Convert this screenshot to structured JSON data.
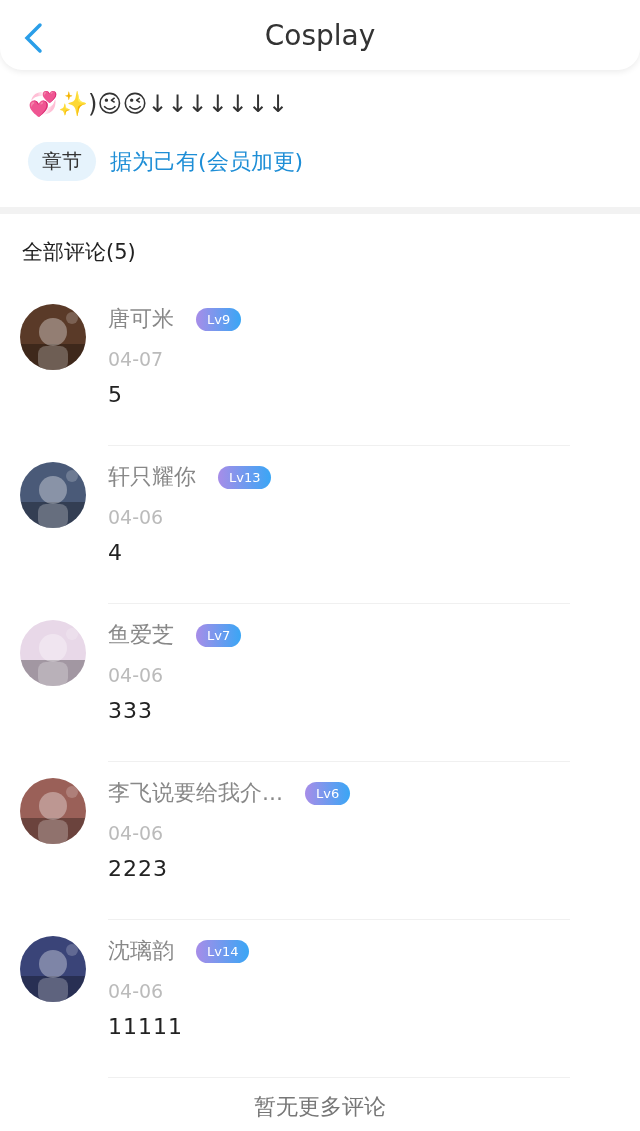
{
  "header": {
    "title": "Cosplay"
  },
  "intro": {
    "text": "💞✨)😉😉↓↓↓↓↓↓↓"
  },
  "chapter": {
    "tag": "章节",
    "title": "据为己有(会员加更)"
  },
  "comments_heading": "全部评论(5)",
  "comments": [
    {
      "name": "唐可米",
      "level": "Lv9",
      "date": "04-07",
      "text": "5"
    },
    {
      "name": "轩只耀你",
      "level": "Lv13",
      "date": "04-06",
      "text": "4"
    },
    {
      "name": "鱼爱芝",
      "level": "Lv7",
      "date": "04-06",
      "text": "333"
    },
    {
      "name": "李飞说要给我介...",
      "level": "Lv6",
      "date": "04-06",
      "text": "2223"
    },
    {
      "name": "沈璃韵",
      "level": "Lv14",
      "date": "04-06",
      "text": "11111"
    }
  ],
  "footer": "暂无更多评论"
}
